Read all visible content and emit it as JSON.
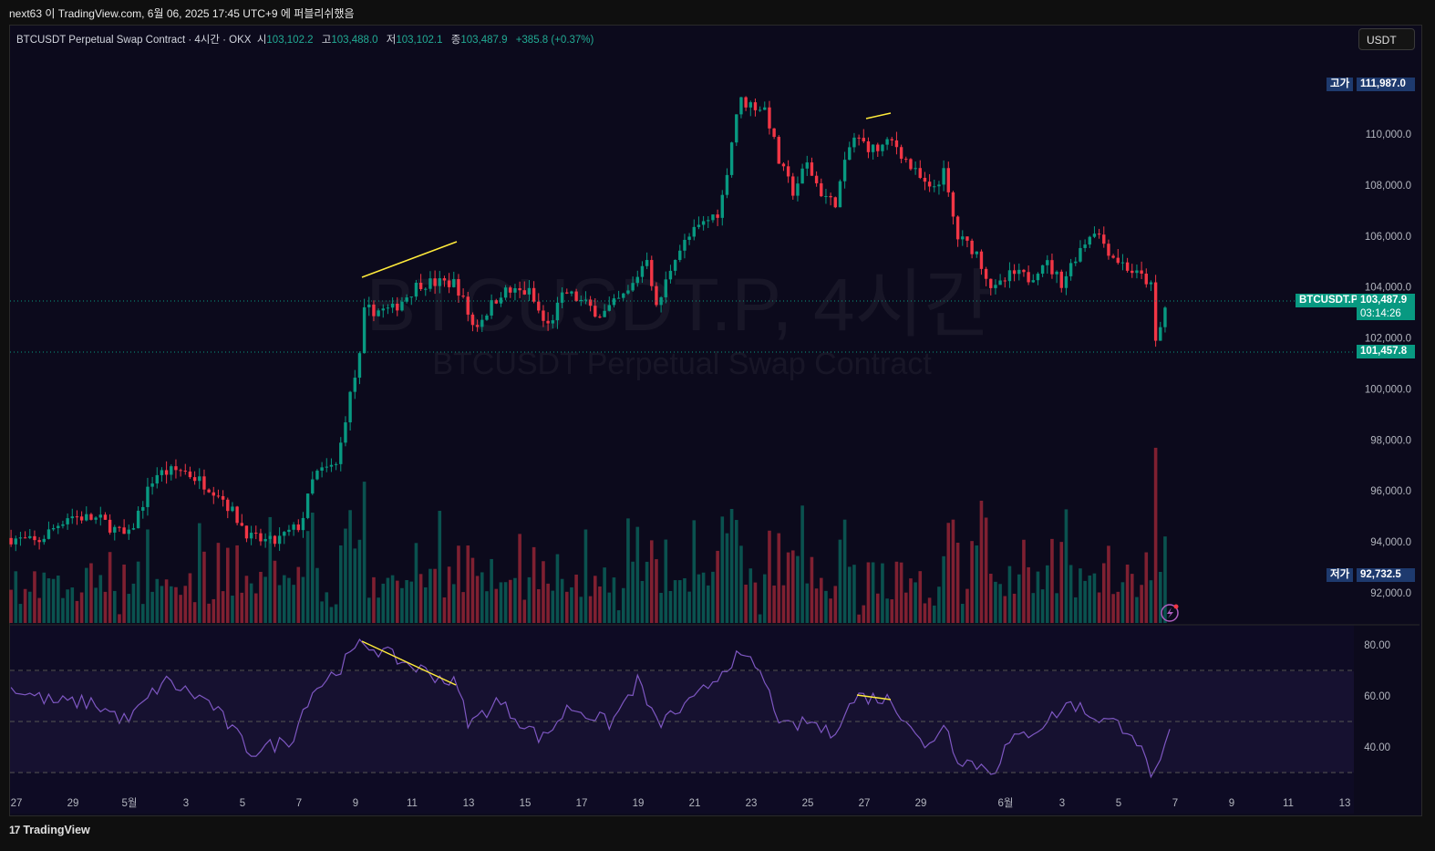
{
  "header": {
    "published_line": "next63 이 TradingView.com, 6월 06, 2025 17:45 UTC+9 에 퍼블리쉬했음"
  },
  "legend": {
    "symbol": "BTCUSDT Perpetual Swap Contract · 4시간 · OKX",
    "open_label": "시",
    "open": "103,102.2",
    "high_label": "고",
    "high": "103,488.0",
    "low_label": "저",
    "low": "103,102.1",
    "close_label": "종",
    "close": "103,487.9",
    "change": "+385.8 (+0.37%)"
  },
  "currency_button": "USDT",
  "watermark": {
    "title": "BTCUSDT.P, 4시간",
    "subtitle": "BTCUSDT Perpetual Swap Contract"
  },
  "price_tags": {
    "high_label": "고가",
    "high_value": "111,987.0",
    "low_label": "저가",
    "low_value": "92,732.5",
    "symbol_tag": "BTCUSDT.P",
    "last_price": "103,487.9",
    "countdown": "03:14:26",
    "line_price": "101,457.8"
  },
  "footer": {
    "brand": "TradingView"
  },
  "colors": {
    "up": "#089981",
    "down": "#f23645",
    "rsi": "#7e57c2",
    "drawing": "#ffeb3b",
    "background": "#0c0a1c"
  },
  "chart_data": [
    {
      "type": "candlestick",
      "title": "BTCUSDT.P 4h",
      "x_unit": "days since Apr 27 2025",
      "price_path": [
        [
          -0.19,
          94150
        ],
        [
          0.71,
          93960
        ],
        [
          1.84,
          95040
        ],
        [
          2.97,
          94860
        ],
        [
          3.94,
          94150
        ],
        [
          4.9,
          96650
        ],
        [
          5.87,
          96830
        ],
        [
          7.16,
          95930
        ],
        [
          8.29,
          94150
        ],
        [
          9.1,
          93960
        ],
        [
          10.06,
          94680
        ],
        [
          10.55,
          96650
        ],
        [
          11.35,
          97010
        ],
        [
          11.68,
          99150
        ],
        [
          12.16,
          101300
        ],
        [
          12.32,
          103090
        ],
        [
          13.29,
          103090
        ],
        [
          14.26,
          104160
        ],
        [
          15.55,
          104160
        ],
        [
          16.19,
          102380
        ],
        [
          17.16,
          103810
        ],
        [
          18.13,
          103810
        ],
        [
          18.77,
          102380
        ],
        [
          19.42,
          103810
        ],
        [
          20.71,
          102910
        ],
        [
          21.68,
          103810
        ],
        [
          22.32,
          105240
        ],
        [
          22.65,
          103090
        ],
        [
          23.29,
          105240
        ],
        [
          23.94,
          106130
        ],
        [
          24.9,
          107030
        ],
        [
          25.23,
          109180
        ],
        [
          25.55,
          111320
        ],
        [
          26.52,
          110970
        ],
        [
          27.0,
          108820
        ],
        [
          27.48,
          107750
        ],
        [
          27.97,
          108820
        ],
        [
          28.45,
          107750
        ],
        [
          28.94,
          107210
        ],
        [
          29.58,
          109890
        ],
        [
          30.39,
          109360
        ],
        [
          31.03,
          109720
        ],
        [
          31.68,
          108640
        ],
        [
          32.32,
          107750
        ],
        [
          32.81,
          108460
        ],
        [
          33.29,
          105950
        ],
        [
          33.94,
          105420
        ],
        [
          34.58,
          103810
        ],
        [
          35.23,
          104520
        ],
        [
          35.87,
          104340
        ],
        [
          36.35,
          105060
        ],
        [
          37.0,
          104160
        ],
        [
          37.48,
          105240
        ],
        [
          38.13,
          106310
        ],
        [
          38.77,
          105240
        ],
        [
          39.58,
          104520
        ],
        [
          40.13,
          104160
        ],
        [
          40.32,
          101660
        ],
        [
          40.71,
          103488
        ]
      ],
      "y_ticks": [
        92000,
        94000,
        96000,
        98000,
        100000,
        102000,
        104000,
        106000,
        108000,
        110000
      ],
      "y_tick_labels": [
        "92,000.0",
        "94,000.0",
        "96,000.0",
        "98,000.0",
        "100,000.0",
        "102,000.0",
        "104,000.0",
        "106,000.0",
        "108,000.0",
        "110,000.0"
      ],
      "x_ticks": [
        0,
        2,
        4,
        6,
        8,
        10,
        12,
        14,
        16,
        18,
        20,
        22,
        24,
        26,
        28,
        30,
        32,
        35,
        37,
        39,
        41,
        43,
        45,
        47
      ],
      "x_tick_labels": [
        "27",
        "29",
        "5월",
        "3",
        "5",
        "7",
        "9",
        "11",
        "13",
        "15",
        "17",
        "19",
        "21",
        "23",
        "25",
        "27",
        "29",
        "6월",
        "3",
        "5",
        "7",
        "9",
        "11",
        "13"
      ],
      "ylim": [
        91500,
        113500
      ]
    },
    {
      "type": "line",
      "title": "RSI",
      "rsi_path": [
        [
          -0.19,
          63
        ],
        [
          1.35,
          57.5
        ],
        [
          2.65,
          57.5
        ],
        [
          3.94,
          50
        ],
        [
          5.23,
          66
        ],
        [
          6.84,
          57.5
        ],
        [
          8.29,
          38
        ],
        [
          9.74,
          43
        ],
        [
          10.39,
          61
        ],
        [
          11.35,
          70
        ],
        [
          12.26,
          81
        ],
        [
          13.61,
          73.6
        ],
        [
          15.55,
          64.6
        ],
        [
          16.03,
          48.6
        ],
        [
          17.0,
          58
        ],
        [
          18.61,
          43
        ],
        [
          19.58,
          56
        ],
        [
          21.03,
          49
        ],
        [
          22.0,
          66
        ],
        [
          22.65,
          49
        ],
        [
          23.94,
          57.5
        ],
        [
          25.39,
          75
        ],
        [
          26.19,
          72
        ],
        [
          27.16,
          47
        ],
        [
          28.13,
          50
        ],
        [
          28.77,
          44.6
        ],
        [
          29.74,
          60
        ],
        [
          30.87,
          58.6
        ],
        [
          31.68,
          49
        ],
        [
          32.16,
          38
        ],
        [
          32.81,
          50
        ],
        [
          33.29,
          36
        ],
        [
          34.58,
          30.7
        ],
        [
          35.06,
          41
        ],
        [
          36.19,
          48
        ],
        [
          37.32,
          57.5
        ],
        [
          38.13,
          52
        ],
        [
          39.45,
          47
        ],
        [
          40.1,
          30.7
        ],
        [
          40.39,
          29
        ],
        [
          40.81,
          45
        ]
      ],
      "y_ticks": [
        40,
        60,
        80
      ],
      "y_tick_labels": [
        "40.00",
        "60.00",
        "80.00"
      ],
      "bands": [
        30,
        50,
        70
      ],
      "ylim": [
        26,
        84
      ]
    }
  ]
}
